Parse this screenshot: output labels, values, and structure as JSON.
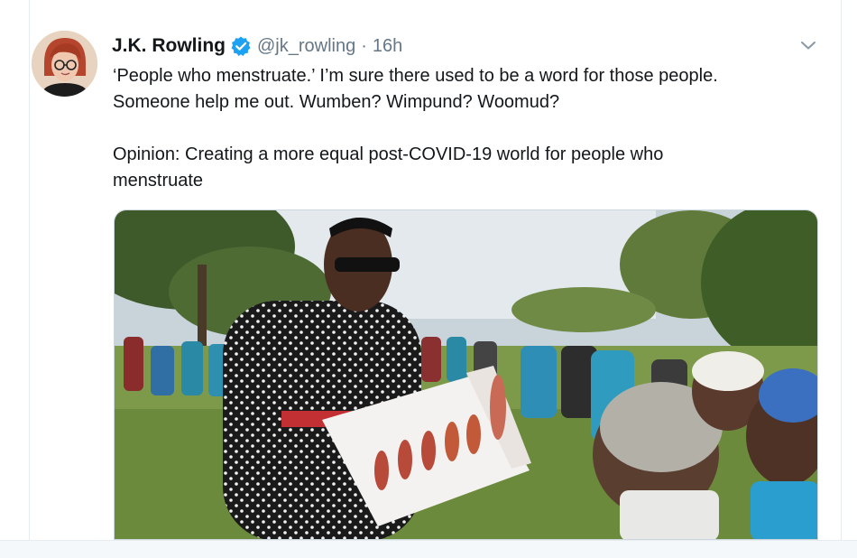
{
  "tweet": {
    "author_name": "J.K. Rowling",
    "handle": "@jk_rowling",
    "separator": "·",
    "time": "16h",
    "text_line_1": "‘People who menstruate.’ I’m sure there used to be a word for those people.",
    "text_line_2": "Someone help me out. Wumben? Wimpund? Woomud?",
    "text_line_3": "Opinion: Creating a more equal post-COVID-19 world for people who",
    "text_line_4": "menstruate"
  },
  "icons": {
    "verified": "verified-badge-icon",
    "more": "chevron-down-icon"
  },
  "colors": {
    "text": "#14171a",
    "secondary": "#657786",
    "verified": "#1da1f2",
    "border": "#e6ecf0"
  }
}
